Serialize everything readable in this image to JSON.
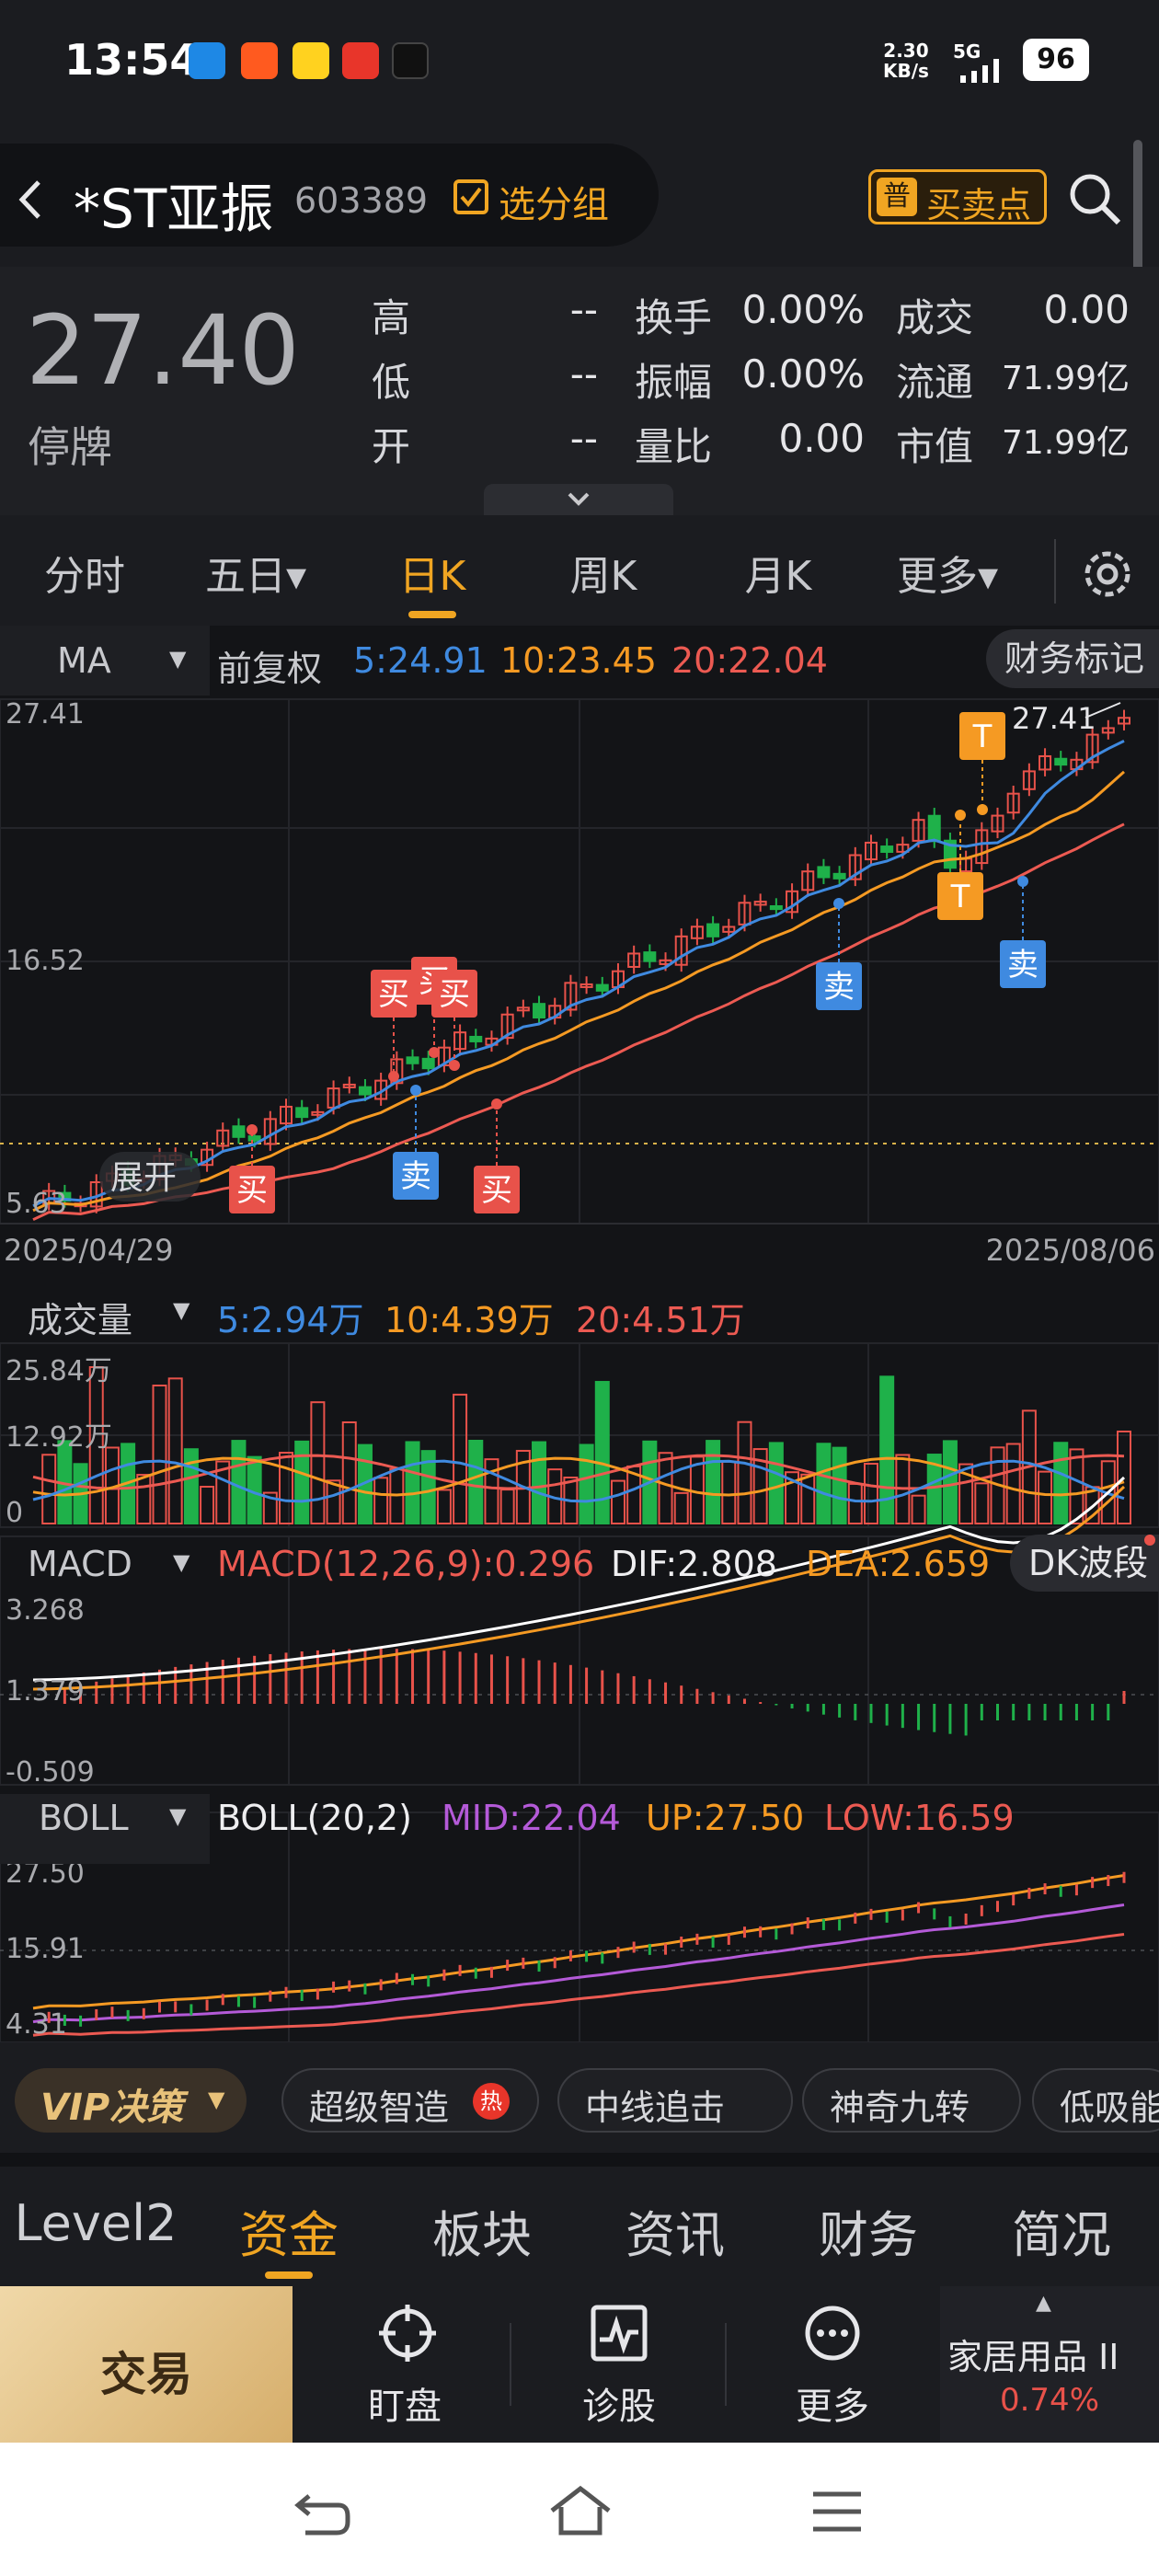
{
  "status": {
    "time": "13:54",
    "net_speed_top": "2.30",
    "net_speed_unit": "KB/s",
    "network": "5G",
    "battery": "96"
  },
  "header": {
    "name": "*ST亚振",
    "code": "603389",
    "group_label": "选分组",
    "buysell_label": "买卖点"
  },
  "quote": {
    "price": "27.40",
    "status": "停牌",
    "rows": [
      [
        {
          "label": "高",
          "value": "--"
        },
        {
          "label": "换手",
          "value": "0.00%"
        },
        {
          "label": "成交",
          "value": "0.00"
        }
      ],
      [
        {
          "label": "低",
          "value": "--"
        },
        {
          "label": "振幅",
          "value": "0.00%"
        },
        {
          "label": "流通",
          "value": "71.99亿"
        }
      ],
      [
        {
          "label": "开",
          "value": "--"
        },
        {
          "label": "量比",
          "value": "0.00"
        },
        {
          "label": "市值",
          "value": "71.99亿"
        }
      ]
    ]
  },
  "period_tabs": [
    "分时",
    "五日▾",
    "日K",
    "周K",
    "月K",
    "更多▾"
  ],
  "period_active_index": 2,
  "ma_bar": {
    "type": "MA",
    "adjust": "前复权",
    "ma5": "5:24.91",
    "ma10": "10:23.45",
    "ma20": "20:22.04",
    "fin_label": "财务标记"
  },
  "kline": {
    "y_ticks": [
      "27.41",
      "16.52",
      "5.63"
    ],
    "date_start": "2025/04/29",
    "date_end": "2025/08/06",
    "max_label": "27.41",
    "expand_label": "展开",
    "signals": {
      "buy": "买",
      "sell": "卖",
      "t": "T"
    }
  },
  "volume": {
    "title": "成交量",
    "ma5": "5:2.94万",
    "ma10": "10:4.39万",
    "ma20": "20:4.51万",
    "y_ticks": [
      "25.84万",
      "12.92万",
      "0"
    ]
  },
  "macd": {
    "title": "MACD",
    "params": "MACD(12,26,9):0.296",
    "dif": "DIF:2.808",
    "dea": "DEA:2.659",
    "extra": "DK波段",
    "y_ticks": [
      "3.268",
      "1.379",
      "-0.509"
    ]
  },
  "boll": {
    "title": "BOLL",
    "params": "BOLL(20,2)",
    "mid": "MID:22.04",
    "up": "UP:27.50",
    "low": "LOW:16.59",
    "y_ticks": [
      "27.50",
      "15.91",
      "4.31"
    ]
  },
  "strategies": {
    "vip": "VIP决策",
    "items": [
      "超级智造",
      "中线追击",
      "神奇九转",
      "低吸能手"
    ],
    "hot": "热"
  },
  "bottom_tabs": [
    "Level2",
    "资金",
    "板块",
    "资讯",
    "财务",
    "简况"
  ],
  "bottom_active_index": 1,
  "actions": {
    "trade": "交易",
    "items": [
      "盯盘",
      "诊股",
      "更多"
    ],
    "sector_name": "家居用品 II",
    "sector_change": "0.74%"
  },
  "colors": {
    "up": "#e8524a",
    "down": "#1fb14a",
    "ma5": "#3f8ae0",
    "ma10": "#f59a23",
    "ma20": "#ec5a52",
    "accent": "#f0a522",
    "mid": "#b45ad8"
  }
}
